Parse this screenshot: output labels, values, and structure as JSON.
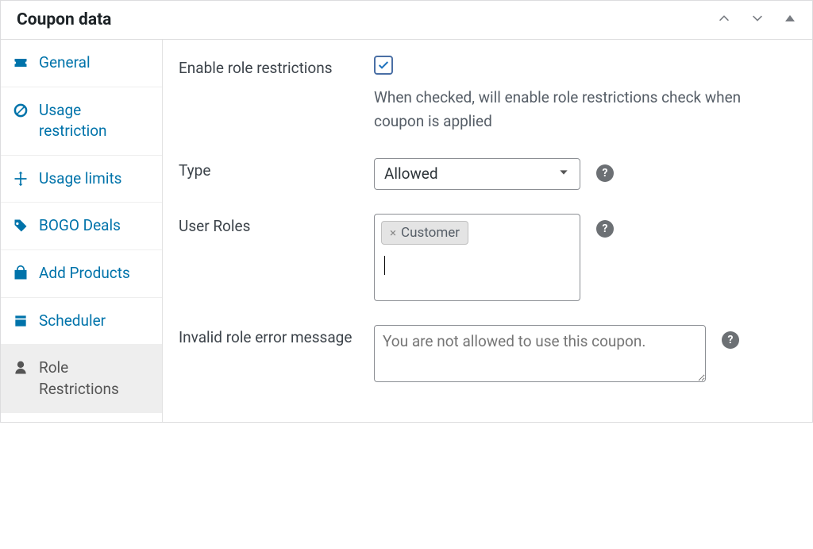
{
  "header": {
    "title": "Coupon data"
  },
  "sidebar": {
    "items": [
      {
        "label": "General"
      },
      {
        "label": "Usage restriction"
      },
      {
        "label": "Usage limits"
      },
      {
        "label": "BOGO Deals"
      },
      {
        "label": "Add Products"
      },
      {
        "label": "Scheduler"
      },
      {
        "label": "Role Restrictions"
      }
    ]
  },
  "fields": {
    "enable_label": "Enable role restrictions",
    "enable_help": "When checked, will enable role restrictions check when coupon is applied",
    "type_label": "Type",
    "type_value": "Allowed",
    "roles_label": "User Roles",
    "roles_tag": "Customer",
    "error_label": "Invalid role error message",
    "error_placeholder": "You are not allowed to use this coupon."
  },
  "help_char": "?"
}
